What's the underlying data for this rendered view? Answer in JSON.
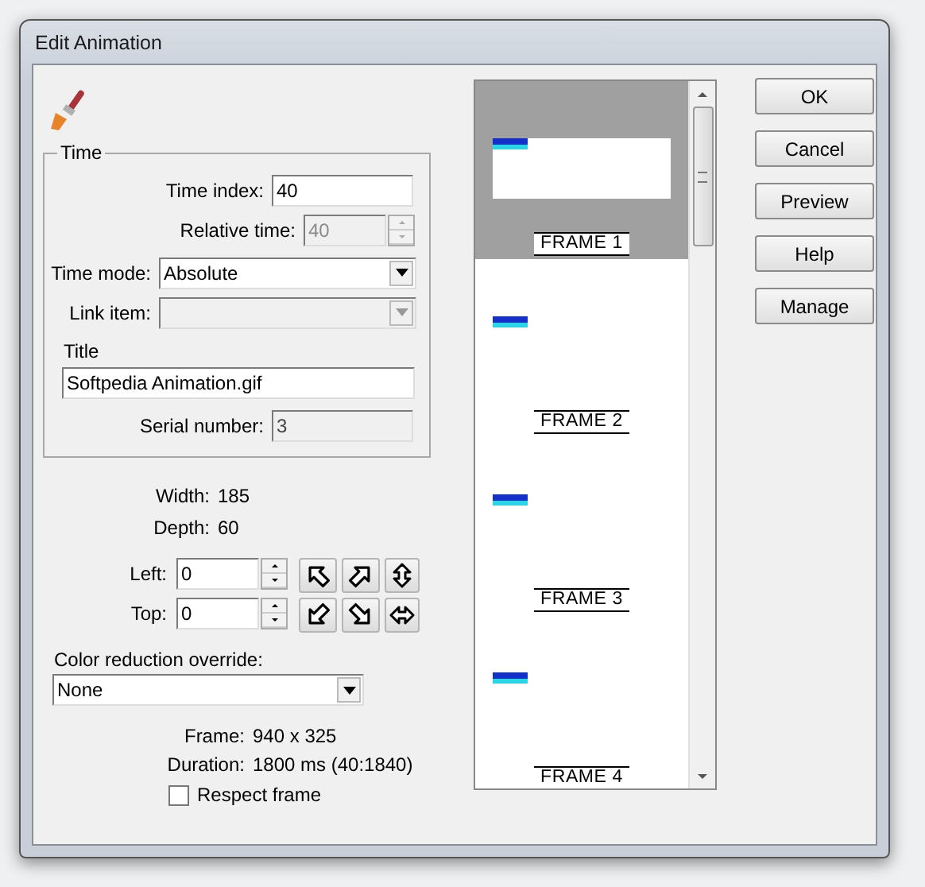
{
  "window": {
    "title": "Edit Animation"
  },
  "time_group": {
    "legend": "Time",
    "time_index": {
      "label": "Time index:",
      "value": "40"
    },
    "relative_time": {
      "label": "Relative time:",
      "value": "40",
      "disabled": true
    },
    "time_mode": {
      "label": "Time mode:",
      "value": "Absolute"
    },
    "link_item": {
      "label": "Link item:",
      "disabled": true
    },
    "title": {
      "label": "Title",
      "value": "Softpedia Animation.gif"
    },
    "serial_number": {
      "label": "Serial number:",
      "value": "3"
    }
  },
  "info": [
    {
      "label": "Width:",
      "value": "185"
    },
    {
      "label": "Depth:",
      "value": "60"
    }
  ],
  "position": [
    {
      "label": "Left:",
      "value": "0"
    },
    {
      "label": "Top:",
      "value": "0"
    }
  ],
  "color_reduction": {
    "label": "Color reduction override:",
    "value": "None"
  },
  "details": [
    {
      "label": "Frame:",
      "value": "940 x 325"
    },
    {
      "label": "Duration:",
      "value": "1800 ms (40:1840)"
    }
  ],
  "respect_frame": {
    "label": "Respect frame",
    "checked": false
  },
  "frames": [
    {
      "label": "FRAME 1",
      "selected": true
    },
    {
      "label": "FRAME 2",
      "selected": false
    },
    {
      "label": "FRAME 3",
      "selected": false
    },
    {
      "label": "FRAME 4",
      "selected": false
    }
  ],
  "buttons": [
    "OK",
    "Cancel",
    "Preview",
    "Help",
    "Manage"
  ]
}
